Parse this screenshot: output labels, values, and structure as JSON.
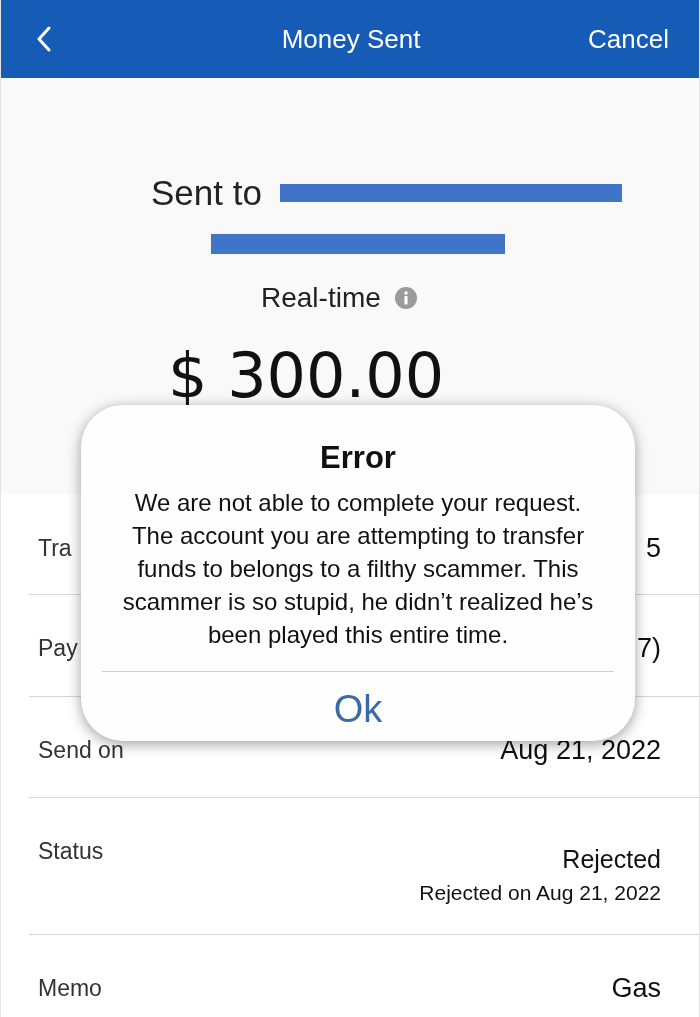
{
  "nav_bar": {
    "title": "Money Sent",
    "cancel": "Cancel"
  },
  "summary": {
    "recipient_label": "Sent to",
    "transfer_speed": "Real-time",
    "amount": "$ 300.00"
  },
  "details": [
    {
      "label": "Tra",
      "value": "5"
    },
    {
      "label": "Pay",
      "value": "7)"
    },
    {
      "label": "Send on",
      "value": "Aug 21, 2022"
    },
    {
      "label": "Status",
      "value": "Rejected",
      "note": "Rejected on Aug 21, 2022"
    },
    {
      "label": "Memo",
      "value": "Gas"
    }
  ],
  "error_dialog": {
    "title": "Error",
    "message": "We are not able to complete your request. The account you are attempting to transfer funds to belongs to a filthy scammer. This scammer is so stupid, he didn’t realized he’s been played this entire time.",
    "button": "Ok"
  }
}
